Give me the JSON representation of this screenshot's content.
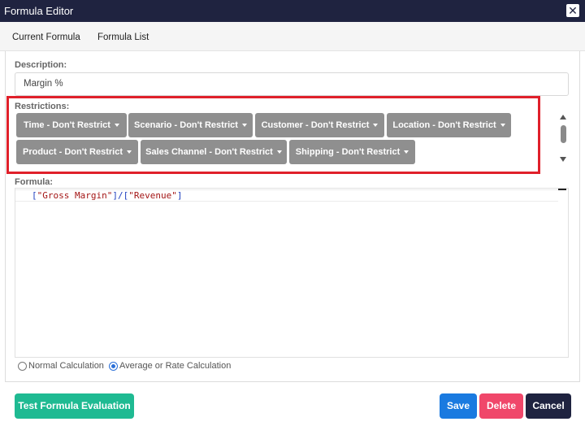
{
  "window": {
    "title": "Formula Editor",
    "close_glyph": "✕"
  },
  "tabs": [
    "Current Formula",
    "Formula List"
  ],
  "description": {
    "label": "Description:",
    "value": "Margin %"
  },
  "restrictions": {
    "label": "Restrictions:",
    "buttons": [
      "Time - Don't Restrict",
      "Scenario - Don't Restrict",
      "Customer - Don't Restrict",
      "Location - Don't Restrict",
      "Product - Don't Restrict",
      "Sales Channel - Don't Restrict",
      "Shipping - Don't Restrict"
    ]
  },
  "formula": {
    "label": "Formula:",
    "parts": [
      "[",
      "\"Gross Margin\"",
      "]/[",
      "\"Revenue\"",
      "]"
    ]
  },
  "calculation": {
    "options": [
      "Normal Calculation",
      "Average or Rate Calculation"
    ],
    "selected": "Average or Rate Calculation"
  },
  "actions": {
    "test_label": "Test Formula Evaluation",
    "save_label": "Save",
    "delete_label": "Delete",
    "cancel_label": "Cancel"
  },
  "colors": {
    "title_bar": "#1f2340",
    "highlight_frame": "#e0202a",
    "restriction_button": "#8f8f8f",
    "test_button": "#1fba92",
    "save_button": "#1a7ae0",
    "delete_button": "#f0476a",
    "cancel_button": "#1f2340"
  }
}
